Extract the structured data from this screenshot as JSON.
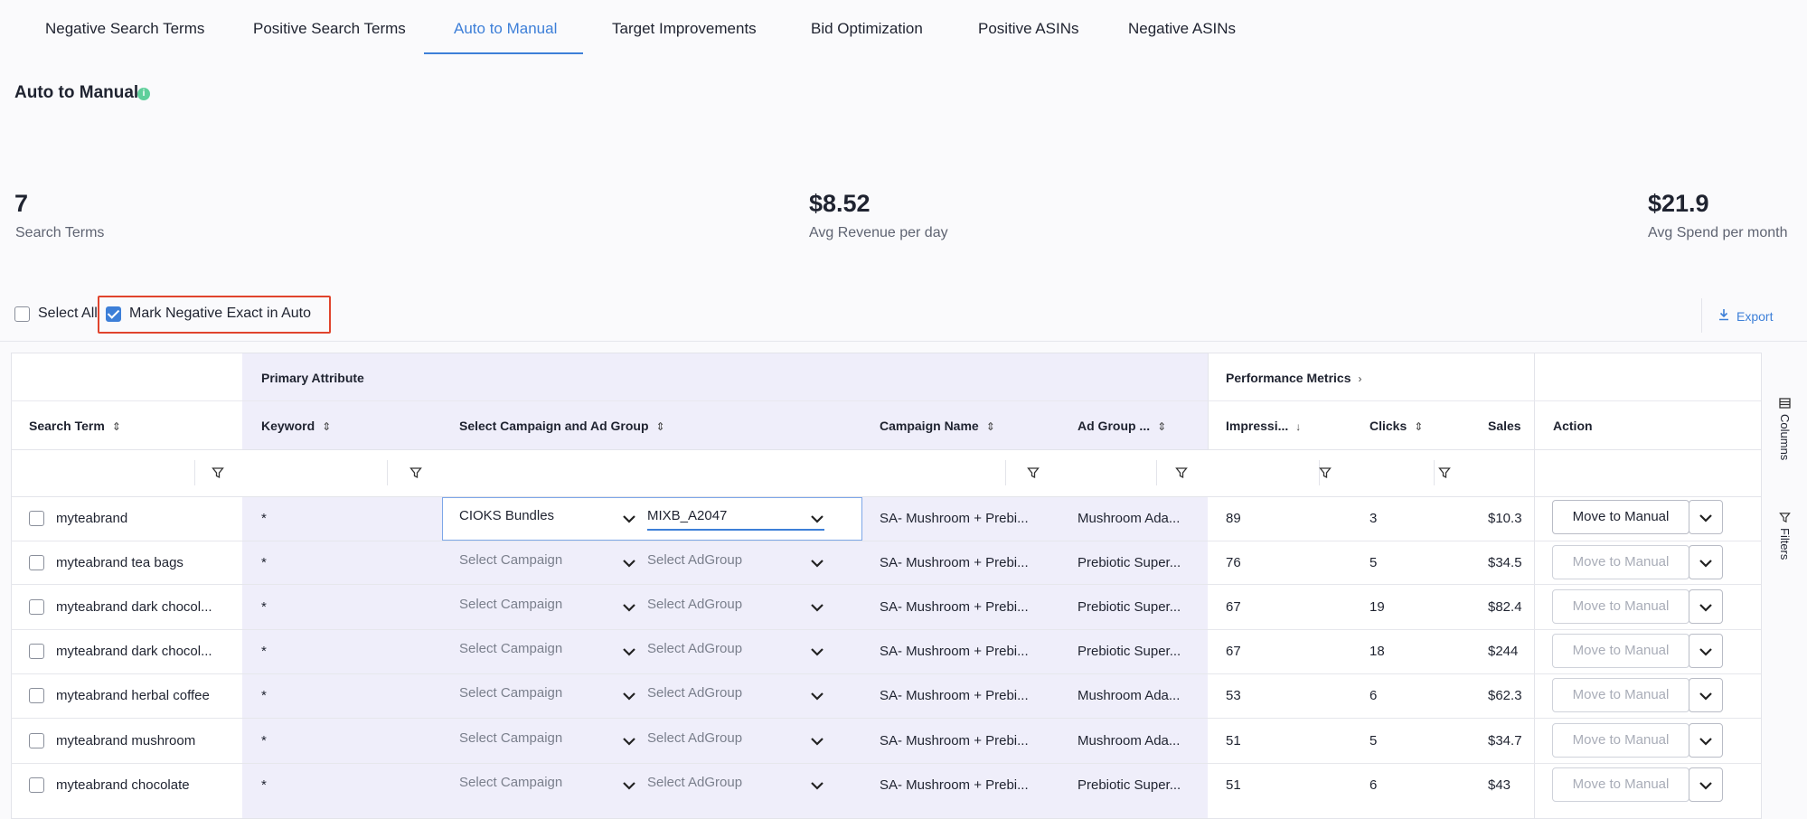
{
  "tabs": [
    {
      "label": "Negative Search Terms"
    },
    {
      "label": "Positive Search Terms"
    },
    {
      "label": "Auto to Manual"
    },
    {
      "label": "Target Improvements"
    },
    {
      "label": "Bid Optimization"
    },
    {
      "label": "Positive ASINs"
    },
    {
      "label": "Negative ASINs"
    }
  ],
  "active_tab": "Auto to Manual",
  "page": {
    "title": "Auto to Manual",
    "info_icon": "info-icon"
  },
  "kpis": [
    {
      "value": "7",
      "label": "Search Terms"
    },
    {
      "value": "$8.52",
      "label": "Avg Revenue per day"
    },
    {
      "value": "$21.9",
      "label": "Avg Spend per month"
    }
  ],
  "controls": {
    "select_all": {
      "label": "Select All",
      "checked": false
    },
    "mark_negative": {
      "label": "Mark Negative Exact in Auto",
      "checked": true
    },
    "export_label": "Export"
  },
  "table": {
    "groups": {
      "primary": "Primary Attribute",
      "performance": "Performance Metrics"
    },
    "columns": {
      "search_term": "Search Term",
      "keyword": "Keyword",
      "select_campaign": "Select Campaign and Ad Group",
      "campaign_name": "Campaign Name",
      "ad_group": "Ad Group ...",
      "impressions": "Impressi...",
      "clicks": "Clicks",
      "sales": "Sales",
      "action": "Action"
    },
    "rows": [
      {
        "search_term": "myteabrand",
        "keyword": "*",
        "campaign": "CIOKS Bundles",
        "adgroup": "MIXB_A2047",
        "campaign_name": "SA- Mushroom + Prebi...",
        "ad_group": "Mushroom Ada...",
        "impressions": "89",
        "clicks": "3",
        "sales": "$10.3",
        "action": "Move to Manual",
        "action_enabled": true
      },
      {
        "search_term": "myteabrand tea bags",
        "keyword": "*",
        "campaign": "Select Campaign",
        "adgroup": "Select AdGroup",
        "campaign_name": "SA- Mushroom + Prebi...",
        "ad_group": "Prebiotic Super...",
        "impressions": "76",
        "clicks": "5",
        "sales": "$34.5",
        "action": "Move to Manual",
        "action_enabled": false
      },
      {
        "search_term": "myteabrand dark chocol...",
        "keyword": "*",
        "campaign": "Select Campaign",
        "adgroup": "Select AdGroup",
        "campaign_name": "SA- Mushroom + Prebi...",
        "ad_group": "Prebiotic Super...",
        "impressions": "67",
        "clicks": "19",
        "sales": "$82.4",
        "action": "Move to Manual",
        "action_enabled": false
      },
      {
        "search_term": "myteabrand dark chocol...",
        "keyword": "*",
        "campaign": "Select Campaign",
        "adgroup": "Select AdGroup",
        "campaign_name": "SA- Mushroom + Prebi...",
        "ad_group": "Prebiotic Super...",
        "impressions": "67",
        "clicks": "18",
        "sales": "$244",
        "action": "Move to Manual",
        "action_enabled": false
      },
      {
        "search_term": "myteabrand herbal coffee",
        "keyword": "*",
        "campaign": "Select Campaign",
        "adgroup": "Select AdGroup",
        "campaign_name": "SA- Mushroom + Prebi...",
        "ad_group": "Mushroom Ada...",
        "impressions": "53",
        "clicks": "6",
        "sales": "$62.3",
        "action": "Move to Manual",
        "action_enabled": false
      },
      {
        "search_term": "myteabrand mushroom",
        "keyword": "*",
        "campaign": "Select Campaign",
        "adgroup": "Select AdGroup",
        "campaign_name": "SA- Mushroom + Prebi...",
        "ad_group": "Mushroom Ada...",
        "impressions": "51",
        "clicks": "5",
        "sales": "$34.7",
        "action": "Move to Manual",
        "action_enabled": false
      },
      {
        "search_term": "myteabrand chocolate",
        "keyword": "*",
        "campaign": "Select Campaign",
        "adgroup": "Select AdGroup",
        "campaign_name": "SA- Mushroom + Prebi...",
        "ad_group": "Prebiotic Super...",
        "impressions": "51",
        "clicks": "6",
        "sales": "$43",
        "action": "Move to Manual",
        "action_enabled": false
      }
    ]
  },
  "side_panel": {
    "columns": "Columns",
    "filters": "Filters"
  },
  "colors": {
    "accent": "#3d7fd8",
    "highlight_box": "#e0442d",
    "group_bg": "#efeefa"
  }
}
